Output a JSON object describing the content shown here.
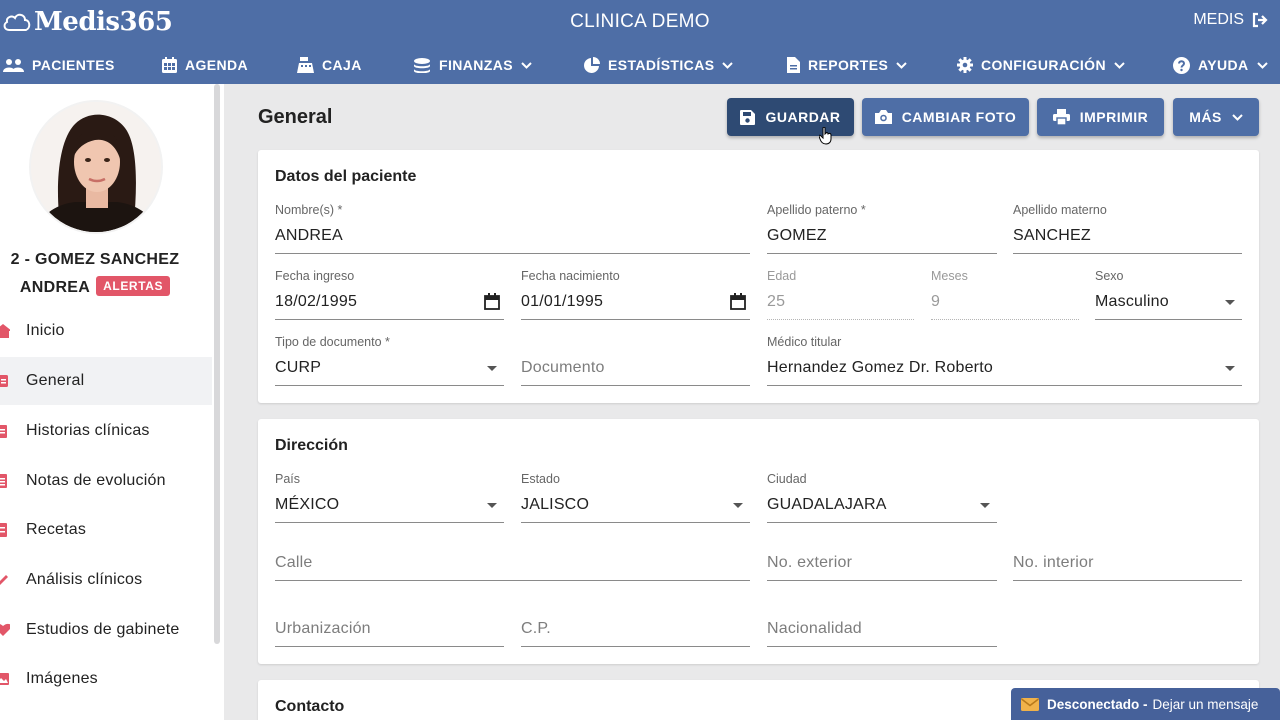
{
  "app": {
    "brand": "Medis365",
    "clinic_name": "CLINICA DEMO",
    "user_label": "MEDIS"
  },
  "nav": [
    {
      "label": "PACIENTES",
      "icon": "users-icon",
      "dropdown": false
    },
    {
      "label": "AGENDA",
      "icon": "calendar-icon",
      "dropdown": false
    },
    {
      "label": "CAJA",
      "icon": "cash-register-icon",
      "dropdown": false
    },
    {
      "label": "FINANZAS",
      "icon": "coins-icon",
      "dropdown": true
    },
    {
      "label": "ESTADÍSTICAS",
      "icon": "pie-chart-icon",
      "dropdown": true
    },
    {
      "label": "REPORTES",
      "icon": "document-icon",
      "dropdown": true
    },
    {
      "label": "CONFIGURACIÓN",
      "icon": "gear-icon",
      "dropdown": true
    },
    {
      "label": "AYUDA",
      "icon": "help-icon",
      "dropdown": true
    }
  ],
  "patient": {
    "name_line1": "2 - GOMEZ SANCHEZ",
    "name_line2": "ANDREA",
    "alert_label": "ALERTAS"
  },
  "sidebar": {
    "items": [
      {
        "label": "Inicio",
        "icon": "home-icon",
        "active": false
      },
      {
        "label": "General",
        "icon": "id-card-icon",
        "active": true
      },
      {
        "label": "Historias clínicas",
        "icon": "clipboard-icon",
        "active": false
      },
      {
        "label": "Notas de evolución",
        "icon": "notes-icon",
        "active": false
      },
      {
        "label": "Recetas",
        "icon": "prescription-icon",
        "active": false
      },
      {
        "label": "Análisis clínicos",
        "icon": "test-tube-icon",
        "active": false
      },
      {
        "label": "Estudios de gabinete",
        "icon": "heartbeat-icon",
        "active": false
      },
      {
        "label": "Imágenes",
        "icon": "image-icon",
        "active": false
      }
    ]
  },
  "page": {
    "title": "General",
    "buttons": {
      "save": "GUARDAR",
      "change_photo": "CAMBIAR FOTO",
      "print": "IMPRIMIR",
      "more": "MÁS"
    }
  },
  "patient_data": {
    "title": "Datos del paciente",
    "nombre": {
      "label": "Nombre(s) *",
      "value": "ANDREA"
    },
    "apellido_paterno": {
      "label": "Apellido paterno *",
      "value": "GOMEZ"
    },
    "apellido_materno": {
      "label": "Apellido materno",
      "value": "SANCHEZ"
    },
    "fecha_ingreso": {
      "label": "Fecha ingreso",
      "value": "18/02/1995"
    },
    "fecha_nacimiento": {
      "label": "Fecha nacimiento",
      "value": "01/01/1995"
    },
    "edad": {
      "label": "Edad",
      "value": "25"
    },
    "meses": {
      "label": "Meses",
      "value": "9"
    },
    "sexo": {
      "label": "Sexo",
      "value": "Masculino"
    },
    "tipo_documento": {
      "label": "Tipo de documento *",
      "value": "CURP"
    },
    "documento": {
      "placeholder": "Documento"
    },
    "medico_titular": {
      "label": "Médico titular",
      "value": "Hernandez Gomez Dr. Roberto"
    }
  },
  "address": {
    "title": "Dirección",
    "pais": {
      "label": "País",
      "value": "MÉXICO"
    },
    "estado": {
      "label": "Estado",
      "value": "JALISCO"
    },
    "ciudad": {
      "label": "Ciudad",
      "value": "GUADALAJARA"
    },
    "calle": {
      "placeholder": "Calle"
    },
    "no_exterior": {
      "placeholder": "No. exterior"
    },
    "no_interior": {
      "placeholder": "No. interior"
    },
    "urbanizacion": {
      "placeholder": "Urbanización"
    },
    "cp": {
      "placeholder": "C.P."
    },
    "nacionalidad": {
      "placeholder": "Nacionalidad"
    }
  },
  "contact": {
    "title": "Contacto"
  },
  "chat": {
    "status": "Desconectado -",
    "action": "Dejar un mensaje"
  },
  "colors": {
    "primary": "#4e6ea6",
    "primary_dark": "#2e4a73",
    "accent": "#e25668",
    "background": "#e9e9ea"
  }
}
